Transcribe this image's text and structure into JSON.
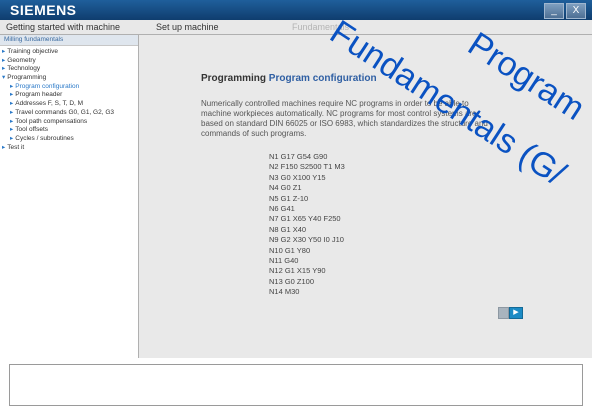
{
  "brand": "SIEMENS",
  "window_controls": {
    "minimize": "_",
    "close": "X"
  },
  "navbar": {
    "tabs": [
      "Getting started with machine",
      "Set up machine",
      "Fundamentals"
    ]
  },
  "sidebar": {
    "header": "Milling fundamentals",
    "items": [
      {
        "label": "Training objective",
        "level": 1
      },
      {
        "label": "Geometry",
        "level": 1
      },
      {
        "label": "Technology",
        "level": 1
      },
      {
        "label": "Programming",
        "level": 1
      },
      {
        "label": "Program configuration",
        "level": 2,
        "active": true
      },
      {
        "label": "Program header",
        "level": 2
      },
      {
        "label": "Addresses F, S, T, D, M",
        "level": 2
      },
      {
        "label": "Travel commands G0, G1, G2, G3",
        "level": 2
      },
      {
        "label": "Tool path compensations",
        "level": 2
      },
      {
        "label": "Tool offsets",
        "level": 2
      },
      {
        "label": "Cycles / subroutines",
        "level": 2
      },
      {
        "label": "Test it",
        "level": 1
      }
    ]
  },
  "main": {
    "heading_prefix": "Programming",
    "heading_accent": "Program configuration",
    "paragraph": "Numerically controlled machines require NC programs in order to be able to machine workpieces automatically. NC programs for most control systems are based on standard DIN 66025 or ISO 6983, which standardizes the structure and commands of such programs.",
    "code_lines": [
      "N1 G17 G54 G90",
      "N2 F150 S2500 T1 M3",
      "N3 G0 X100 Y15",
      "N4 G0 Z1",
      "N5 G1 Z-10",
      "N6 G41",
      "N7 G1 X65 Y40 F250",
      "N8 G1 X40",
      "N9 G2 X30 Y50 I0 J10",
      "N10 G1 Y80",
      "N11 G40",
      "N12 G1 X15 Y90",
      "N13 G0 Z100",
      "N14 M30"
    ],
    "next_icon": "play-icon"
  },
  "overlay": {
    "line1": "Program",
    "line2": "Fundamentals (G/"
  },
  "colors": {
    "title_bar": "#0f3d6e",
    "accent": "#2f5fa3",
    "overlay_text": "#0a52c2"
  }
}
